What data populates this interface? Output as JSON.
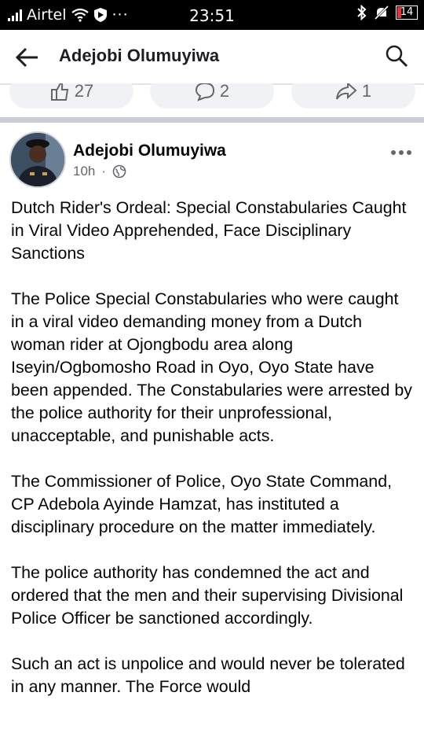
{
  "status_bar": {
    "carrier": "Airtel",
    "time": "23:51",
    "battery": "14"
  },
  "header": {
    "title": "Adejobi Olumuyiwa"
  },
  "reactions": {
    "likes": "27",
    "comments": "2",
    "shares": "1"
  },
  "post": {
    "author": "Adejobi Olumuyiwa",
    "time": "10h",
    "paragraphs": [
      "Dutch Rider's Ordeal: Special Constabularies Caught in Viral Video Apprehended, Face Disciplinary Sanctions",
      "The Police Special Constabularies who were caught in a viral video demanding money from a Dutch woman rider at Ojongbodu area along Iseyin/Ogbomosho Road in Oyo, Oyo State have been appended. The Constabularies were arrested by the police authority for their unprofessional, unacceptable, and punishable acts.",
      "The Commissioner of Police, Oyo State Command, CP Adebola Ayinde Hamzat, has instituted a disciplinary procedure on the matter immediately.",
      "The police authority has condemned the act and ordered that the men and their supervising Divisional Police Officer be sanctioned accordingly.",
      "Such an act is unpolice and would never be tolerated in any manner. The Force would"
    ]
  },
  "icons": [
    "signal-icon",
    "wifi-icon",
    "shield-icon",
    "bluetooth-icon",
    "mute-icon",
    "battery-icon",
    "back-arrow-icon",
    "search-icon",
    "like-icon",
    "comment-icon",
    "share-icon",
    "globe-icon",
    "more-options-icon"
  ]
}
